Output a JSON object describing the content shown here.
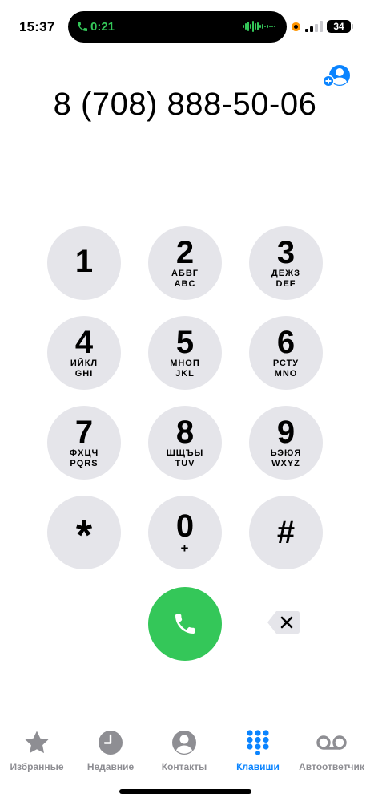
{
  "status_bar": {
    "time": "15:37",
    "call_timer": "0:21",
    "battery": "34"
  },
  "dialer": {
    "number": "8 (708) 888-50-06"
  },
  "keypad": [
    {
      "digit": "1",
      "letters_ru": "",
      "letters_en": ""
    },
    {
      "digit": "2",
      "letters_ru": "АБВГ",
      "letters_en": "ABC"
    },
    {
      "digit": "3",
      "letters_ru": "ДЕЖЗ",
      "letters_en": "DEF"
    },
    {
      "digit": "4",
      "letters_ru": "ИЙКЛ",
      "letters_en": "GHI"
    },
    {
      "digit": "5",
      "letters_ru": "МНОП",
      "letters_en": "JKL"
    },
    {
      "digit": "6",
      "letters_ru": "РСТУ",
      "letters_en": "MNO"
    },
    {
      "digit": "7",
      "letters_ru": "ФХЦЧ",
      "letters_en": "PQRS"
    },
    {
      "digit": "8",
      "letters_ru": "ШЩЪЫ",
      "letters_en": "TUV"
    },
    {
      "digit": "9",
      "letters_ru": "ЬЭЮЯ",
      "letters_en": "WXYZ"
    },
    {
      "digit": "*",
      "letters_ru": "",
      "letters_en": ""
    },
    {
      "digit": "0",
      "letters_ru": "+",
      "letters_en": ""
    },
    {
      "digit": "#",
      "letters_ru": "",
      "letters_en": ""
    }
  ],
  "tabs": [
    {
      "label": "Избранные",
      "icon": "star-icon"
    },
    {
      "label": "Недавние",
      "icon": "clock-icon"
    },
    {
      "label": "Контакты",
      "icon": "person-icon"
    },
    {
      "label": "Клавиши",
      "icon": "keypad-icon"
    },
    {
      "label": "Автоответчик",
      "icon": "voicemail-icon"
    }
  ],
  "colors": {
    "accent": "#0a84ff",
    "call_green": "#34c759",
    "key_gray": "#e5e5ea",
    "inactive_gray": "#8e8e93"
  }
}
